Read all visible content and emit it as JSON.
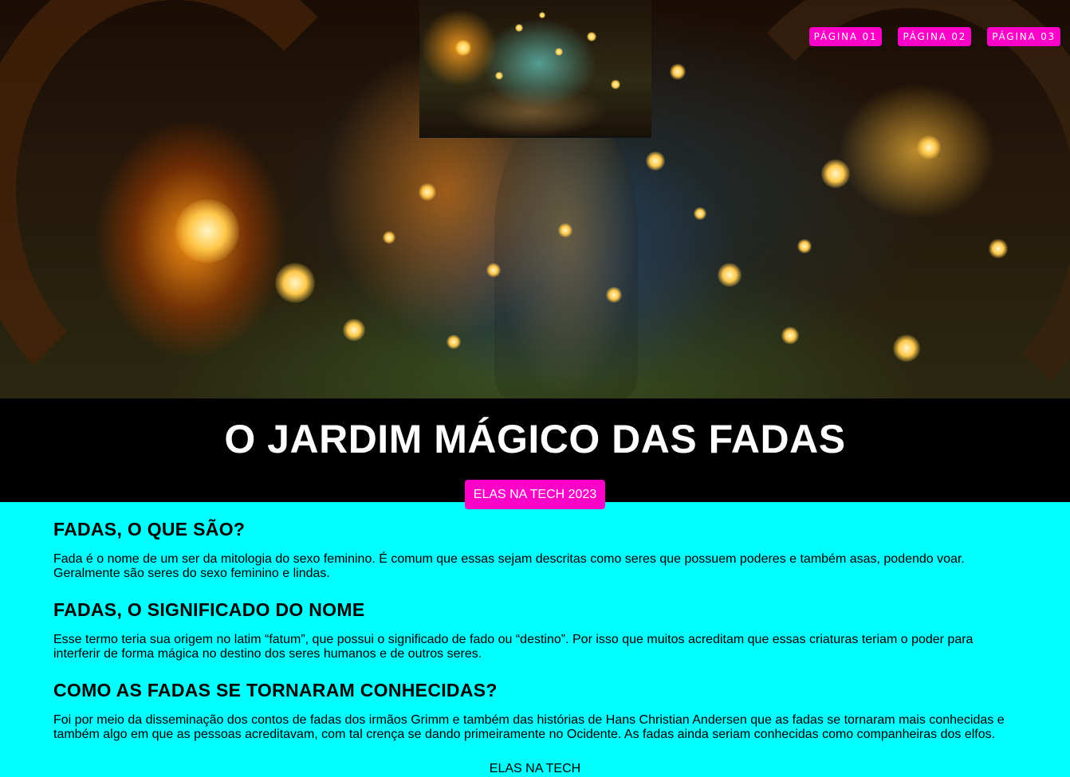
{
  "header": {
    "hero_image": "fantasy-forest-fireflies-image",
    "thumbnail_image": "forest-path-glowing-trees-image",
    "nav": [
      {
        "label": "PÁGINA 01"
      },
      {
        "label": "PÁGINA 02"
      },
      {
        "label": "PÁGINA 03"
      }
    ]
  },
  "banner": {
    "title": "O JARDIM MÁGICO DAS FADAS",
    "badge": "ELAS NA TECH 2023"
  },
  "sections": [
    {
      "heading": "FADAS, O QUE SÃO?",
      "text": "Fada é o nome de um ser da mitologia do sexo feminino. É comum que essas sejam descritas como seres que possuem poderes e também asas, podendo voar. Geralmente são seres do sexo feminino e lindas."
    },
    {
      "heading": "FADAS, O SIGNIFICADO DO NOME",
      "text": "Esse termo teria sua origem no latim “fatum”, que possui o significado de fado ou “destino”. Por isso que muitos acreditam que essas criaturas teriam o poder para interferir de forma mágica no destino dos seres humanos e de outros seres."
    },
    {
      "heading": "COMO AS FADAS SE TORNARAM CONHECIDAS?",
      "text": "Foi por meio da disseminação dos contos de fadas dos irmãos Grimm e também das histórias de Hans Christian Andersen que as fadas se tornaram mais conhecidas e também algo em que as pessoas acreditavam, com tal crença se dando primeiramente no Ocidente. As fadas ainda seriam conhecidas como companheiras dos elfos."
    }
  ],
  "footer": {
    "text": "ELAS NA TECH"
  },
  "colors": {
    "accent": "#ff00c8",
    "page_background": "#00ffff",
    "banner_background": "#000000"
  }
}
